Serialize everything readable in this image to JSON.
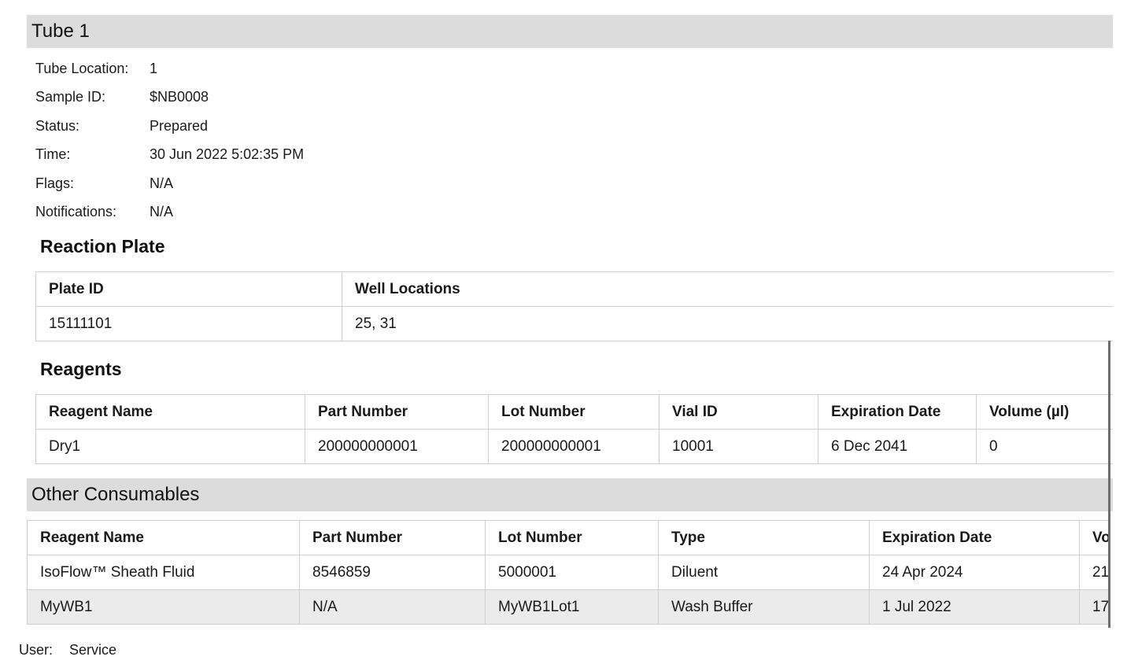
{
  "tube": {
    "title": "Tube 1",
    "fields": [
      {
        "label": "Tube Location:",
        "value": "1"
      },
      {
        "label": "Sample ID:",
        "value": "$NB0008"
      },
      {
        "label": "Status:",
        "value": "Prepared"
      },
      {
        "label": "Time:",
        "value": "30 Jun 2022 5:02:35 PM"
      },
      {
        "label": "Flags:",
        "value": "N/A"
      },
      {
        "label": "Notifications:",
        "value": "N/A"
      }
    ]
  },
  "reaction_plate": {
    "title": "Reaction Plate",
    "columns": [
      "Plate ID",
      "Well Locations"
    ],
    "rows": [
      [
        "15111101",
        "25, 31"
      ]
    ]
  },
  "reagents": {
    "title": "Reagents",
    "columns": [
      "Reagent Name",
      "Part Number",
      "Lot Number",
      "Vial ID",
      "Expiration Date",
      "Volume (µl)"
    ],
    "rows": [
      [
        "Dry1",
        "200000000001",
        "200000000001",
        "10001",
        "6 Dec 2041",
        "0"
      ]
    ]
  },
  "other_consumables": {
    "title": "Other Consumables",
    "columns": [
      "Reagent Name",
      "Part Number",
      "Lot Number",
      "Type",
      "Expiration Date",
      "Vol"
    ],
    "rows": [
      [
        "IsoFlow™ Sheath Fluid",
        "8546859",
        "5000001",
        "Diluent",
        "24 Apr 2024",
        "21"
      ],
      [
        "MyWB1",
        "N/A",
        "MyWB1Lot1",
        "Wash Buffer",
        "1 Jul 2022",
        "17"
      ]
    ]
  },
  "footer": {
    "label": "User:",
    "value": "Service"
  }
}
